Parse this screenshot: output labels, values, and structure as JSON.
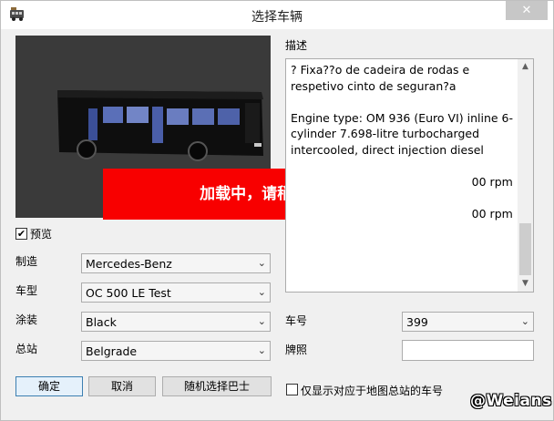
{
  "window": {
    "title": "选择车辆",
    "close_glyph": "✕"
  },
  "preview": {
    "loading_text": "加载中，请稍候...",
    "checkbox_label": "预览",
    "checked_glyph": "✔"
  },
  "form": {
    "manufacturer": {
      "label": "制造",
      "value": "Mercedes-Benz"
    },
    "model": {
      "label": "车型",
      "value": "OC 500 LE Test"
    },
    "livery": {
      "label": "涂装",
      "value": "Black"
    },
    "depot": {
      "label": "总站",
      "value": "Belgrade"
    }
  },
  "buttons": {
    "ok": "确定",
    "cancel": "取消",
    "random": "随机选择巴士"
  },
  "description": {
    "label": "描述",
    "text": "? Fixa??o de cadeira de rodas e respetivo cinto de seguran?a\n\nEngine type: OM 936 (Euro VI) inline 6-cylinder 7.698-litre turbocharged intercooled, direct injection diesel\n\n                                                  00 rpm\n\n                                                  00 rpm"
  },
  "vehicle_number": {
    "label": "车号",
    "value": "399"
  },
  "plate": {
    "label": "牌照",
    "value": ""
  },
  "depot_filter": {
    "label": "仅显示对应于地图总站的车号"
  },
  "watermark": "@Weians",
  "icons": {
    "chevron": "⌄",
    "scroll_up": "▲",
    "scroll_down": "▼"
  }
}
